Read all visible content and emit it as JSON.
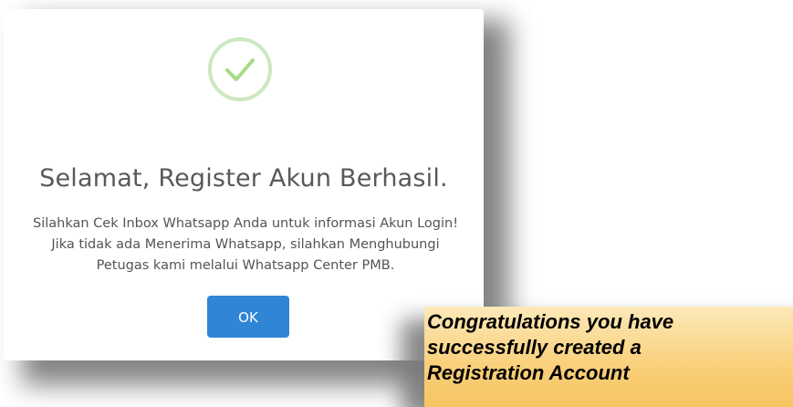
{
  "dialog": {
    "title": "Selamat, Register Akun Berhasil.",
    "message": "Silahkan Cek Inbox Whatsapp Anda untuk informasi Akun Login! Jika tidak ada Menerima Whatsapp, silahkan Menghubungi Petugas kami melalui Whatsapp Center PMB.",
    "ok_label": "OK",
    "success_icon": "check-circle-icon",
    "colors": {
      "button": "#3085d6",
      "icon_ring": "#cbe8bf",
      "icon_check": "#a5dc86"
    }
  },
  "callout": {
    "text": "Congratulations you have successfully created a Registration Account",
    "color": "#f9cf79"
  }
}
